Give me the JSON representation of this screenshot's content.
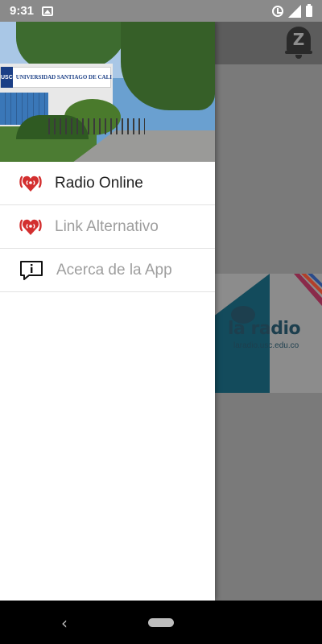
{
  "status_bar": {
    "time": "9:31",
    "icons": [
      "image-notification-icon",
      "alarm-icon",
      "signal-icon",
      "battery-icon"
    ]
  },
  "background_app": {
    "header_badge_letter": "Z",
    "banner_brand": "la radio",
    "banner_url": "laradio.usc.edu.co"
  },
  "drawer": {
    "header_image": {
      "sign_logo_text": "USC",
      "sign_text": "UNIVERSIDAD SANTIAGO DE CALI"
    },
    "items": [
      {
        "label": "Radio Online",
        "icon": "radio-broadcast-icon",
        "state": "active"
      },
      {
        "label": "Link Alternativo",
        "icon": "radio-broadcast-icon",
        "state": "inactive"
      },
      {
        "label": "Acerca de la App",
        "icon": "info-message-icon",
        "state": "inactive"
      }
    ]
  },
  "colors": {
    "icon_red": "#d32f2f",
    "active_text": "#212121",
    "inactive_text": "#9e9e9e",
    "scrim": "#6d6d6d",
    "banner_teal": "#134b5c"
  },
  "nav_bar": {
    "back_glyph": "‹"
  }
}
